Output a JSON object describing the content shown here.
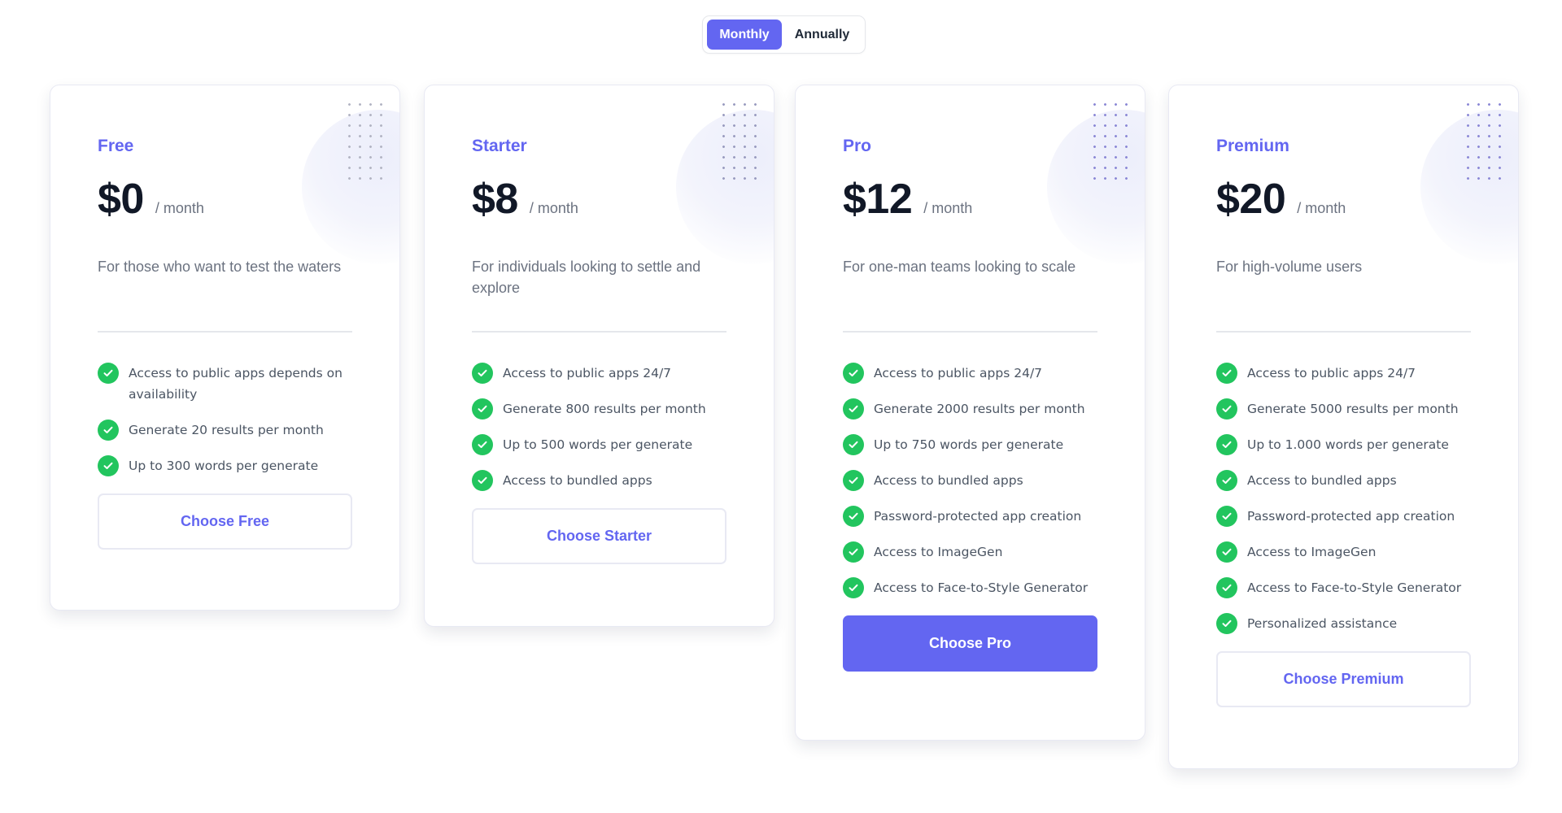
{
  "billing_toggle": {
    "options": [
      "Monthly",
      "Annually"
    ],
    "selected": "Monthly"
  },
  "colors": {
    "accent": "#6366f1",
    "check": "#22c55e",
    "text_dark": "#111827",
    "text_muted": "#6b7280"
  },
  "plans": [
    {
      "name": "Free",
      "price": "$0",
      "period": "/ month",
      "description": "For those who want to test the waters",
      "features": [
        "Access to public apps depends on availability",
        "Generate 20 results per month",
        "Up to 300 words per generate"
      ],
      "cta": "Choose Free",
      "highlighted": false
    },
    {
      "name": "Starter",
      "price": "$8",
      "period": "/ month",
      "description": "For individuals looking to settle and explore",
      "features": [
        "Access to public apps 24/7",
        "Generate 800 results per month",
        "Up to 500 words per generate",
        "Access to bundled apps"
      ],
      "cta": "Choose Starter",
      "highlighted": false
    },
    {
      "name": "Pro",
      "price": "$12",
      "period": "/ month",
      "description": "For one-man teams looking to scale",
      "features": [
        "Access to public apps 24/7",
        "Generate 2000 results per month",
        "Up to 750 words per generate",
        "Access to bundled apps",
        "Password-protected app creation",
        "Access to ImageGen",
        "Access to Face-to-Style Generator"
      ],
      "cta": "Choose Pro",
      "highlighted": true
    },
    {
      "name": "Premium",
      "price": "$20",
      "period": "/ month",
      "description": "For high-volume users",
      "features": [
        "Access to public apps 24/7",
        "Generate 5000 results per month",
        "Up to 1.000 words per generate",
        "Access to bundled apps",
        "Password-protected app creation",
        "Access to ImageGen",
        "Access to Face-to-Style Generator",
        "Personalized assistance"
      ],
      "cta": "Choose Premium",
      "highlighted": false
    }
  ]
}
